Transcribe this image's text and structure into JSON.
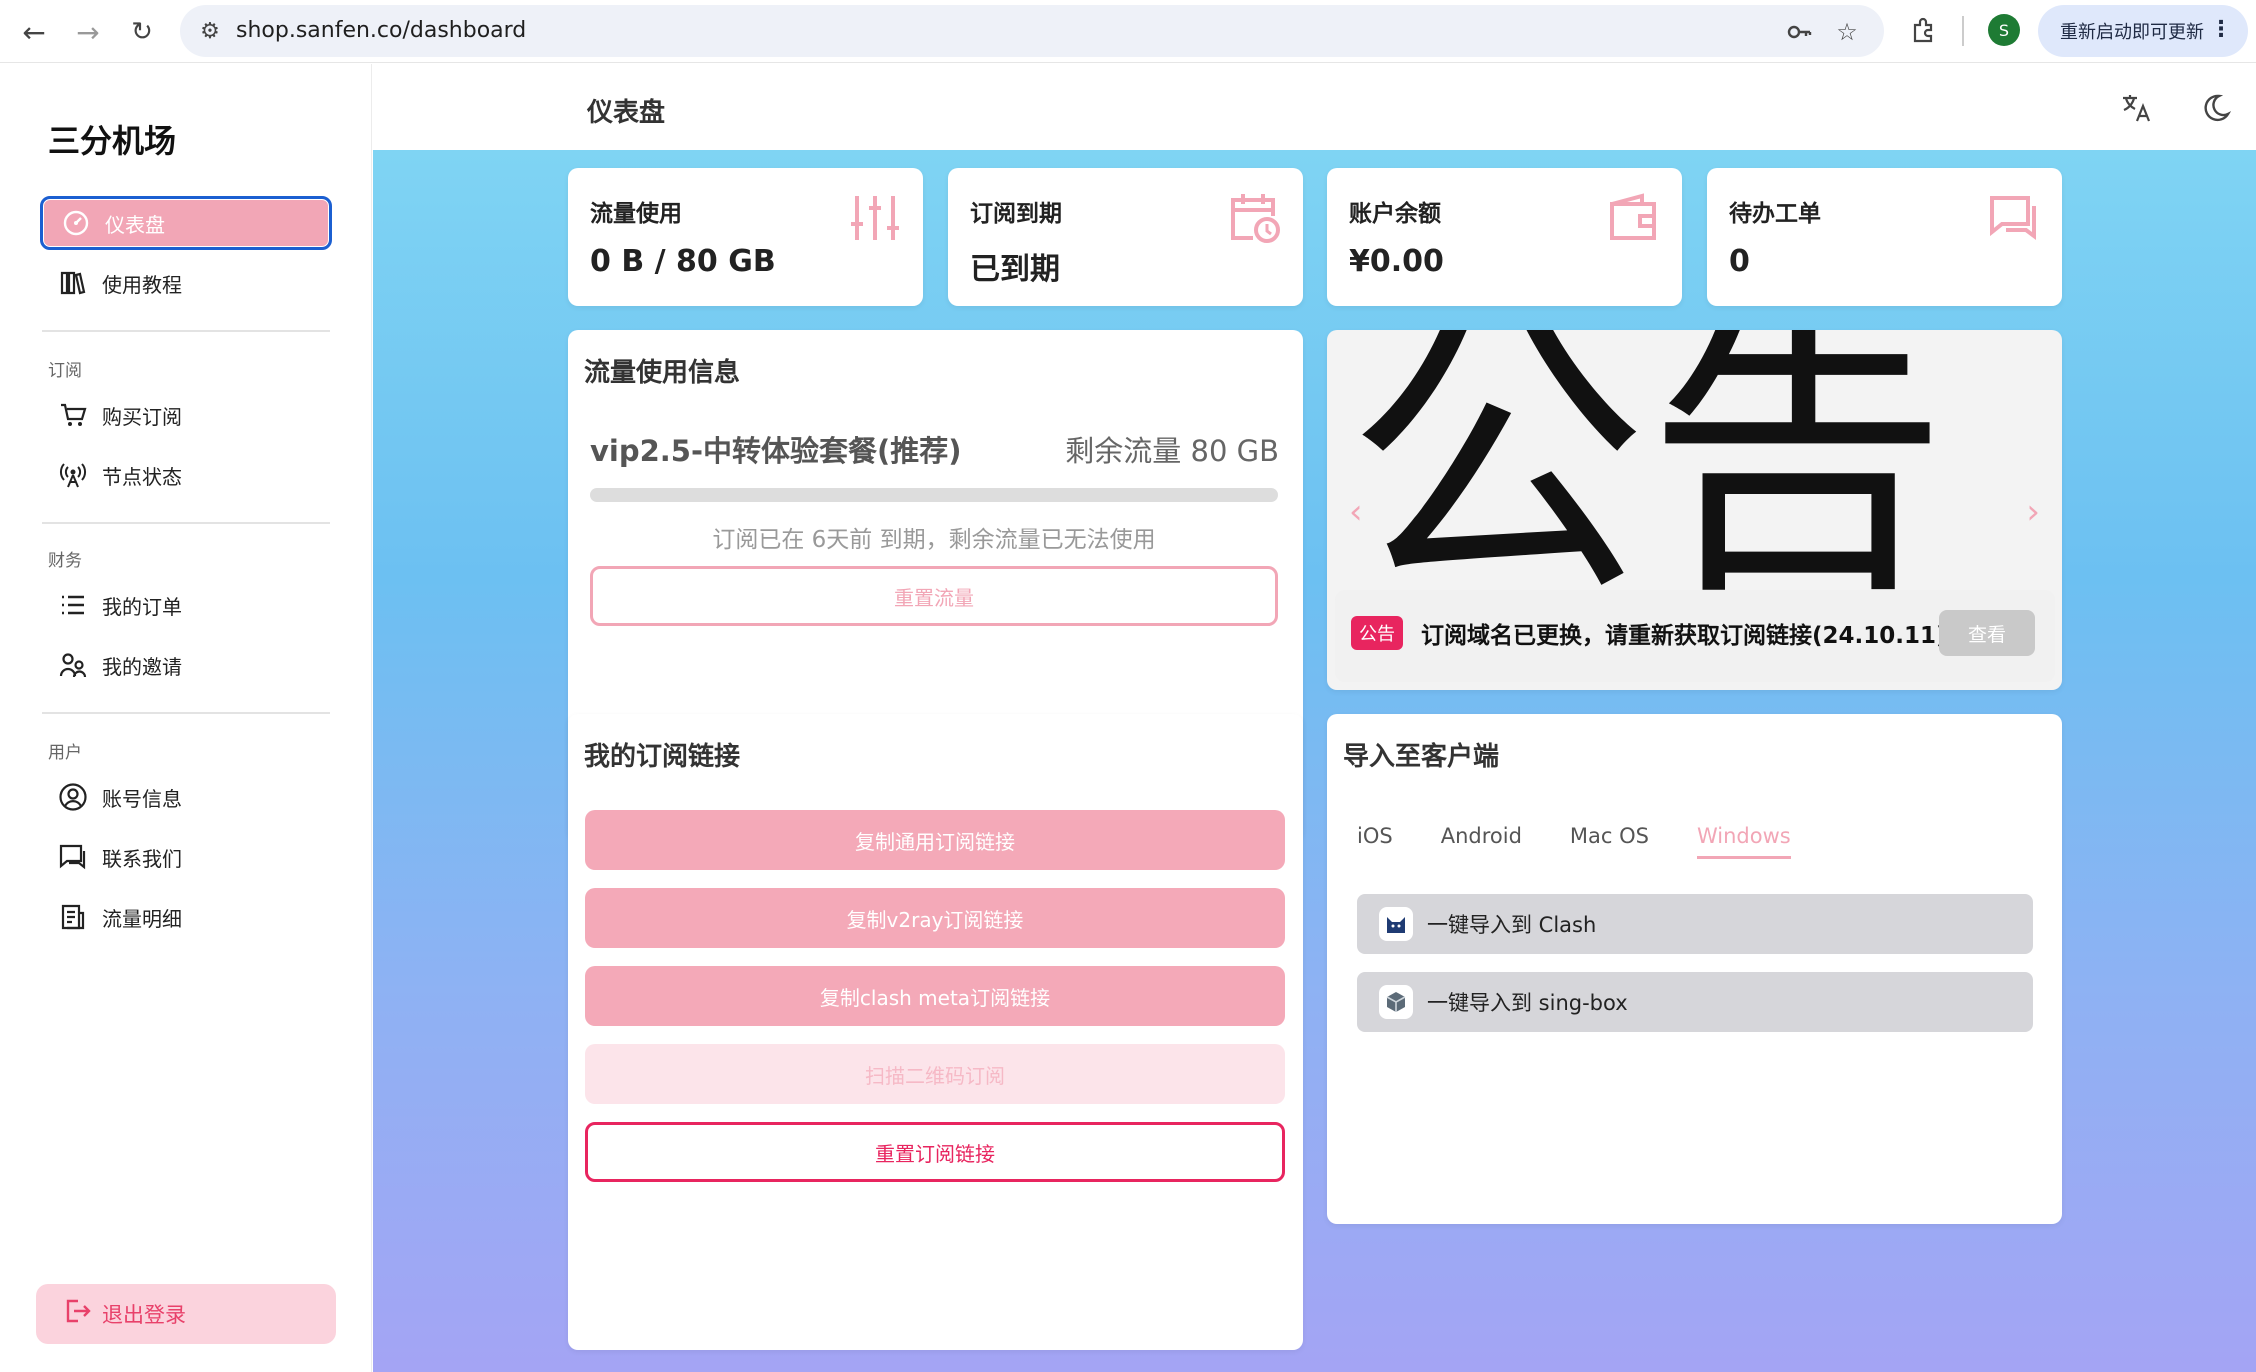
{
  "browser": {
    "url": "shop.sanfen.co/dashboard",
    "update_label": "重新启动即可更新",
    "profile_initial": "S"
  },
  "sidebar": {
    "brand": "三分机场",
    "items": [
      {
        "label": "仪表盘",
        "icon": "dashboard-icon"
      },
      {
        "label": "使用教程",
        "icon": "book-icon"
      },
      {
        "group": "订阅"
      },
      {
        "label": "购买订阅",
        "icon": "cart-icon"
      },
      {
        "label": "节点状态",
        "icon": "signal-icon"
      },
      {
        "group": "财务"
      },
      {
        "label": "我的订单",
        "icon": "list-icon"
      },
      {
        "label": "我的邀请",
        "icon": "users-icon"
      },
      {
        "group": "用户"
      },
      {
        "label": "账号信息",
        "icon": "account-icon"
      },
      {
        "label": "联系我们",
        "icon": "chat-icon"
      },
      {
        "label": "流量明细",
        "icon": "report-icon"
      }
    ],
    "logout": "退出登录"
  },
  "header": {
    "title": "仪表盘"
  },
  "stats": [
    {
      "label": "流量使用",
      "value": "0 B / 80 GB",
      "icon": "sliders-icon"
    },
    {
      "label": "订阅到期",
      "value": "已到期",
      "icon": "calendar-clock-icon"
    },
    {
      "label": "账户余额",
      "value": "¥0.00",
      "icon": "wallet-icon"
    },
    {
      "label": "待办工单",
      "value": "0",
      "icon": "ticket-chat-icon"
    }
  ],
  "traffic": {
    "title": "流量使用信息",
    "plan": "vip2.5-中转体验套餐(推荐)",
    "remaining": "剩余流量 80 GB",
    "used_fraction": 0.0,
    "note": "订阅已在 6天前 到期，剩余流量已无法使用",
    "reset_button": "重置流量"
  },
  "notice": {
    "glyph": "公告",
    "tag": "公告",
    "text": "订阅域名已更换，请重新获取订阅链接(24.10.11)",
    "view_button": "查看"
  },
  "subscription": {
    "title": "我的订阅链接",
    "buttons": [
      "复制通用订阅链接",
      "复制v2ray订阅链接",
      "复制clash meta订阅链接",
      "扫描二维码订阅",
      "重置订阅链接"
    ]
  },
  "import": {
    "title": "导入至客户端",
    "tabs": [
      "iOS",
      "Android",
      "Mac OS",
      "Windows"
    ],
    "active_tab": "Windows",
    "items": [
      "一键导入到 Clash",
      "一键导入到 sing-box"
    ]
  }
}
